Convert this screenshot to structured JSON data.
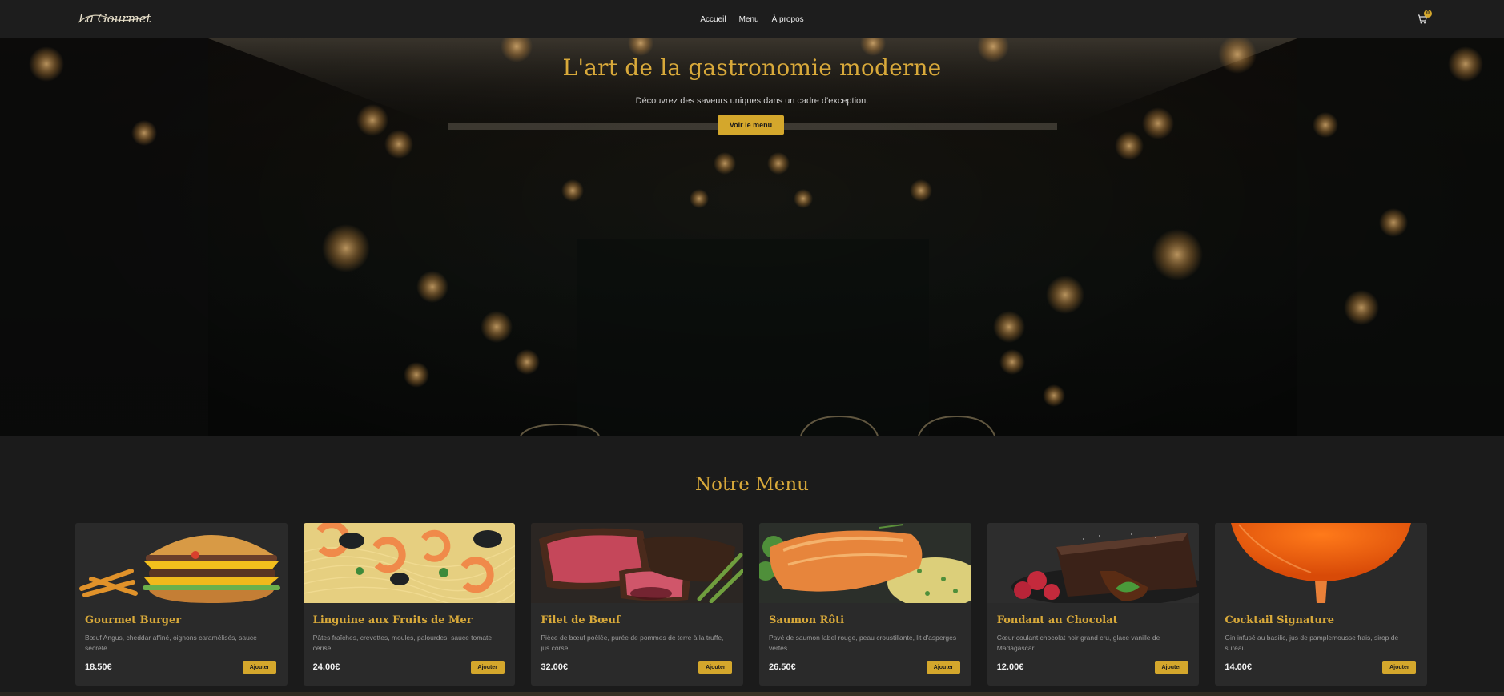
{
  "colors": {
    "accent": "#d4a72c",
    "title_gold": "#d8a93a",
    "background": "#1b1b1b",
    "card_background": "#2a2a2a"
  },
  "navbar": {
    "logo_text": "La Gourmet",
    "links": [
      {
        "label": "Accueil"
      },
      {
        "label": "Menu"
      },
      {
        "label": "À propos"
      }
    ],
    "cart_icon": "cart-icon",
    "cart_count": "0"
  },
  "hero": {
    "title": "L'art de la gastronomie moderne",
    "subtitle": "Découvrez des saveurs uniques dans un cadre d'exception.",
    "button_label": "Voir le menu"
  },
  "menu": {
    "title": "Notre Menu",
    "add_label": "Ajouter",
    "items": [
      {
        "name": "Gourmet Burger",
        "description": "Bœuf Angus, cheddar affiné, oignons caramélisés, sauce secrète.",
        "price": "18.50€"
      },
      {
        "name": "Linguine aux Fruits de Mer",
        "description": "Pâtes fraîches, crevettes, moules, palourdes, sauce tomate cerise.",
        "price": "24.00€"
      },
      {
        "name": "Filet de Bœuf",
        "description": "Pièce de bœuf poêlée, purée de pommes de terre à la truffe, jus corsé.",
        "price": "32.00€"
      },
      {
        "name": "Saumon Rôti",
        "description": "Pavé de saumon label rouge, peau croustillante, lit d'asperges vertes.",
        "price": "26.50€"
      },
      {
        "name": "Fondant au Chocolat",
        "description": "Cœur coulant chocolat noir grand cru, glace vanille de Madagascar.",
        "price": "12.00€"
      },
      {
        "name": "Cocktail Signature",
        "description": "Gin infusé au basilic, jus de pamplemousse frais, sirop de sureau.",
        "price": "14.00€"
      }
    ]
  }
}
